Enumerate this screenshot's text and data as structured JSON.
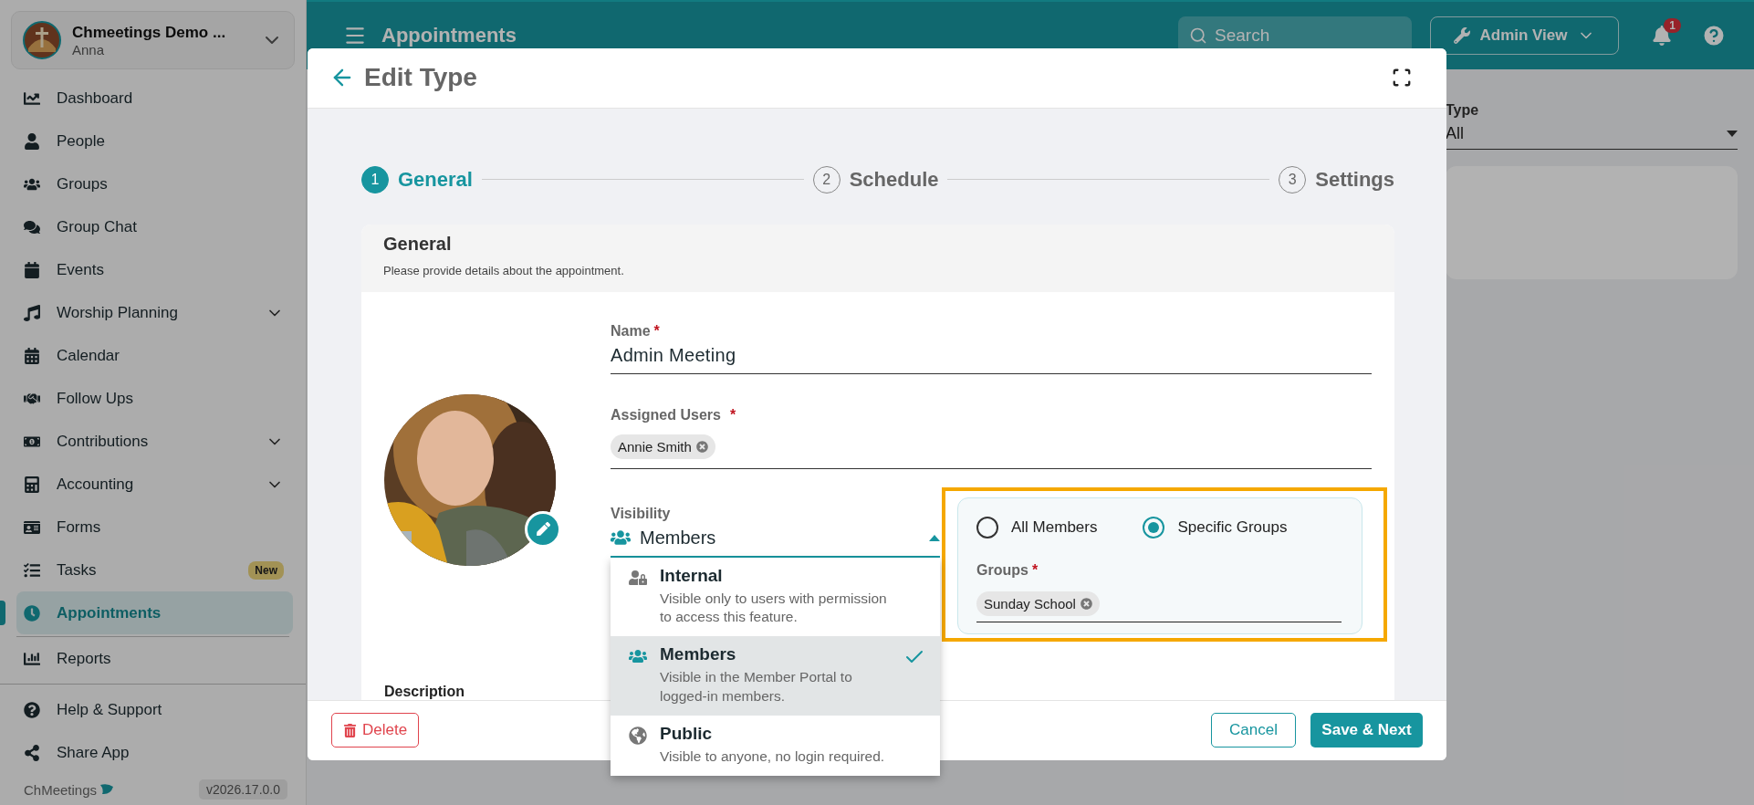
{
  "organization": {
    "name": "Chmeetings Demo ...",
    "user": "Anna"
  },
  "sidebar": {
    "items": [
      {
        "label": "Dashboard",
        "selected": false,
        "expandable": false
      },
      {
        "label": "People",
        "selected": false,
        "expandable": false
      },
      {
        "label": "Groups",
        "selected": false,
        "expandable": false
      },
      {
        "label": "Group Chat",
        "selected": false,
        "expandable": false
      },
      {
        "label": "Events",
        "selected": false,
        "expandable": false
      },
      {
        "label": "Worship Planning",
        "selected": false,
        "expandable": true
      },
      {
        "label": "Calendar",
        "selected": false,
        "expandable": false
      },
      {
        "label": "Follow Ups",
        "selected": false,
        "expandable": false
      },
      {
        "label": "Contributions",
        "selected": false,
        "expandable": true
      },
      {
        "label": "Accounting",
        "selected": false,
        "expandable": true
      },
      {
        "label": "Forms",
        "selected": false,
        "expandable": false
      },
      {
        "label": "Tasks",
        "selected": false,
        "expandable": false,
        "badge": "New"
      },
      {
        "label": "Appointments",
        "selected": true,
        "expandable": false
      },
      {
        "label": "Reports",
        "selected": false,
        "expandable": false
      }
    ],
    "footer_items": [
      {
        "label": "Help & Support"
      },
      {
        "label": "Share App"
      }
    ],
    "brand": "ChMeetings",
    "version": "v2026.17.0.0"
  },
  "header": {
    "title": "Appointments",
    "search": {
      "placeholder": "Search"
    },
    "view_button": "Admin View",
    "notifications": "1"
  },
  "filter": {
    "label": "Type",
    "value": "All"
  },
  "modal": {
    "title": "Edit Type",
    "steps": [
      {
        "number": "1",
        "label": "General",
        "selected": true
      },
      {
        "number": "2",
        "label": "Schedule",
        "selected": false
      },
      {
        "number": "3",
        "label": "Settings",
        "selected": false
      }
    ],
    "section": {
      "title": "General",
      "subtitle": "Please provide details about the appointment."
    },
    "name_field": {
      "label": "Name",
      "required_mark": "*",
      "value": "Admin Meeting"
    },
    "assigned_users": {
      "label": "Assigned Users",
      "required_mark": "*",
      "chips": [
        "Annie Smith"
      ]
    },
    "visibility": {
      "label": "Visibility",
      "value": "Members",
      "expanded": true,
      "options": [
        {
          "title": "Internal",
          "description": "Visible only to users with permission to access this feature.",
          "selected": false
        },
        {
          "title": "Members",
          "description": "Visible in the Member Portal to logged-in members.",
          "selected": true
        },
        {
          "title": "Public",
          "description": "Visible to anyone, no login required.",
          "selected": false
        }
      ]
    },
    "audience": {
      "highlighted": true,
      "options": [
        {
          "label": "All Members",
          "selected": false
        },
        {
          "label": "Specific Groups",
          "selected": true
        }
      ],
      "groups": {
        "label": "Groups",
        "required_mark": "*",
        "chips": [
          "Sunday School"
        ]
      }
    },
    "description_label": "Description",
    "buttons": {
      "delete": "Delete",
      "cancel": "Cancel",
      "save": "Save & Next"
    }
  }
}
